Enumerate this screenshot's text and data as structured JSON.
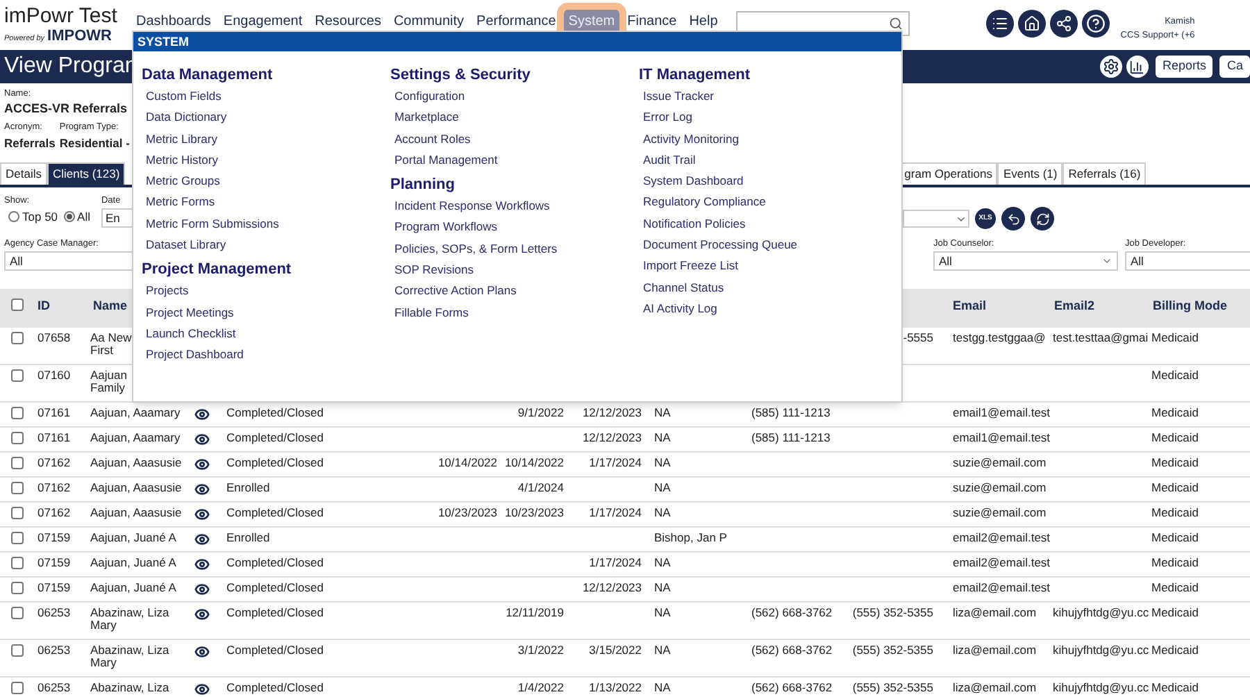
{
  "header": {
    "app_title": "imPowr Test",
    "powered_by": "Powered by",
    "brand": "IMPOWR"
  },
  "nav": [
    {
      "label": "Dashboards",
      "selected": false
    },
    {
      "label": "Engagement",
      "selected": false
    },
    {
      "label": "Resources",
      "selected": false
    },
    {
      "label": "Community",
      "selected": false
    },
    {
      "label": "Performance",
      "selected": false
    },
    {
      "label": "System",
      "selected": true
    },
    {
      "label": "Finance",
      "selected": false
    },
    {
      "label": "Help",
      "selected": false
    }
  ],
  "user": {
    "name": "Kamish",
    "role": "CCS Support+ (+6"
  },
  "page_bar": {
    "title": "View Progran",
    "buttons": [
      "Reports",
      "Ca"
    ]
  },
  "program": {
    "name_label": "Name:",
    "name": "ACCES-VR Referrals",
    "fields": [
      {
        "label": "Acronym:",
        "value": "Referrals"
      },
      {
        "label": "Program Type:",
        "value": "Residential -"
      }
    ]
  },
  "tabs": [
    {
      "label": "Details",
      "selected": false
    },
    {
      "label": "Clients (123)",
      "selected": true
    },
    {
      "label": "gram Operations",
      "selected": false
    },
    {
      "label": "Events (1)",
      "selected": false
    },
    {
      "label": "Referrals (16)",
      "selected": false
    }
  ],
  "filters": {
    "show_label": "Show:",
    "options": [
      {
        "label": "Top 50",
        "selected": false
      },
      {
        "label": "All",
        "selected": true
      }
    ],
    "date_label": "Date",
    "date_value": "En",
    "xls": "XLS",
    "selects": [
      {
        "label": "Agency Case Manager:",
        "value": "All"
      },
      {
        "label": "Job Counselor:",
        "value": "All"
      },
      {
        "label": "Job Developer:",
        "value": "All"
      }
    ]
  },
  "table": {
    "columns": {
      "id": "ID",
      "name": "Name",
      "email": "Email",
      "email2": "Email2",
      "billing_mode": "Billing Mode"
    },
    "header_checked": false,
    "rows": [
      {
        "checked": false,
        "id": "07658",
        "name": "Aa New\nFirst",
        "status": "",
        "date_1": "",
        "date_2": "",
        "date_3": "",
        "column_9": "",
        "phone_1": "",
        "phone_2": "-5555",
        "email": "testgg.testggaa@",
        "email2": "test.testtaa@gmai",
        "billing_mode": "Medicaid"
      },
      {
        "checked": false,
        "id": "07160",
        "name": "Aajuan\nFamily",
        "status": "",
        "date_1": "",
        "date_2": "",
        "date_3": "",
        "column_9": "",
        "phone_1": "",
        "phone_2": "",
        "email": "",
        "email2": "",
        "billing_mode": "Medicaid"
      },
      {
        "checked": false,
        "id": "07161",
        "name": "Aajuan, Aaamary",
        "status": "Completed/Closed",
        "date_1": "",
        "date_2": "9/1/2022",
        "date_3": "12/12/2023",
        "column_9": "NA",
        "phone_1": "(585) 111-1213",
        "phone_2": "",
        "email": "email1@email.test",
        "email2": "",
        "billing_mode": "Medicaid"
      },
      {
        "checked": false,
        "id": "07161",
        "name": "Aajuan, Aaamary",
        "status": "Completed/Closed",
        "date_1": "",
        "date_2": "",
        "date_3": "12/12/2023",
        "column_9": "NA",
        "phone_1": "(585) 111-1213",
        "phone_2": "",
        "email": "email1@email.test",
        "email2": "",
        "billing_mode": "Medicaid"
      },
      {
        "checked": false,
        "id": "07162",
        "name": "Aajuan, Aaasusie",
        "status": "Completed/Closed",
        "date_1": "10/14/2022",
        "date_2": "10/14/2022",
        "date_3": "1/17/2024",
        "column_9": "NA",
        "phone_1": "",
        "phone_2": "",
        "email": "suzie@email.com",
        "email2": "",
        "billing_mode": "Medicaid"
      },
      {
        "checked": false,
        "id": "07162",
        "name": "Aajuan, Aaasusie",
        "status": "Enrolled",
        "date_1": "",
        "date_2": "4/1/2024",
        "date_3": "",
        "column_9": "NA",
        "phone_1": "",
        "phone_2": "",
        "email": "suzie@email.com",
        "email2": "",
        "billing_mode": "Medicaid"
      },
      {
        "checked": false,
        "id": "07162",
        "name": "Aajuan, Aaasusie",
        "status": "Completed/Closed",
        "date_1": "10/23/2023",
        "date_2": "10/23/2023",
        "date_3": "1/17/2024",
        "column_9": "NA",
        "phone_1": "",
        "phone_2": "",
        "email": "suzie@email.com",
        "email2": "",
        "billing_mode": "Medicaid"
      },
      {
        "checked": false,
        "id": "07159",
        "name": "Aajuan, Juané A",
        "status": "Enrolled",
        "date_1": "",
        "date_2": "",
        "date_3": "",
        "column_9": "Bishop, Jan P",
        "phone_1": "",
        "phone_2": "",
        "email": "email2@email.test",
        "email2": "",
        "billing_mode": "Medicaid"
      },
      {
        "checked": false,
        "id": "07159",
        "name": "Aajuan, Juané A",
        "status": "Completed/Closed",
        "date_1": "",
        "date_2": "",
        "date_3": "1/17/2024",
        "column_9": "NA",
        "phone_1": "",
        "phone_2": "",
        "email": "email2@email.test",
        "email2": "",
        "billing_mode": "Medicaid"
      },
      {
        "checked": false,
        "id": "07159",
        "name": "Aajuan, Juané A",
        "status": "Completed/Closed",
        "date_1": "",
        "date_2": "",
        "date_3": "12/12/2023",
        "column_9": "NA",
        "phone_1": "",
        "phone_2": "",
        "email": "email2@email.test",
        "email2": "",
        "billing_mode": "Medicaid"
      },
      {
        "checked": false,
        "id": "06253",
        "name": "Abazinaw, Liza\nMary",
        "status": "Completed/Closed",
        "date_1": "",
        "date_2": "12/11/2019",
        "date_3": "",
        "column_9": "NA",
        "phone_1": "(562) 668-3762",
        "phone_2": "(555) 352-5355",
        "email": "liza@email.com",
        "email2": "kihujyfhtdg@yu.cc",
        "billing_mode": "Medicaid"
      },
      {
        "checked": false,
        "id": "06253",
        "name": "Abazinaw, Liza\nMary",
        "status": "Completed/Closed",
        "date_1": "",
        "date_2": "3/1/2022",
        "date_3": "3/15/2022",
        "column_9": "NA",
        "phone_1": "(562) 668-3762",
        "phone_2": "(555) 352-5355",
        "email": "liza@email.com",
        "email2": "kihujyfhtdg@yu.cc",
        "billing_mode": "Medicaid"
      },
      {
        "checked": false,
        "id": "06253",
        "name": "Abazinaw, Liza",
        "status": "Completed/Closed",
        "date_1": "",
        "date_2": "1/4/2022",
        "date_3": "1/13/2022",
        "column_9": "NA",
        "phone_1": "(562) 668-3762",
        "phone_2": "(555) 352-5355",
        "email": "liza@email.com",
        "email2": "kihujyfhtdg@yu.cc",
        "billing_mode": "Medicaid"
      }
    ]
  },
  "menu": {
    "title": "SYSTEM",
    "columns": [
      [
        {
          "title": "Data Management",
          "items": [
            "Custom Fields",
            "Data Dictionary",
            "Metric Library",
            "Metric History",
            "Metric Groups",
            "Metric Forms",
            "Metric Form Submissions",
            "Dataset Library"
          ]
        },
        {
          "title": "Project Management",
          "items": [
            "Projects",
            "Project Meetings",
            "Launch Checklist",
            "Project Dashboard"
          ]
        }
      ],
      [
        {
          "title": "Settings & Security",
          "items": [
            "Configuration",
            "Marketplace",
            "Account Roles",
            "Portal Management"
          ]
        },
        {
          "title": "Planning",
          "items": [
            "Incident Response Workflows",
            "Program Workflows",
            "Policies, SOPs, & Form Letters",
            "SOP Revisions",
            "Corrective Action Plans",
            "Fillable Forms"
          ]
        }
      ],
      [
        {
          "title": "IT Management",
          "items": [
            "Issue Tracker",
            "Error Log",
            "Activity Monitoring",
            "Audit Trail",
            "System Dashboard",
            "Regulatory Compliance",
            "Notification Policies",
            "Document Processing Queue",
            "Import Freeze List",
            "Channel Status",
            "AI Activity Log"
          ]
        }
      ]
    ]
  }
}
